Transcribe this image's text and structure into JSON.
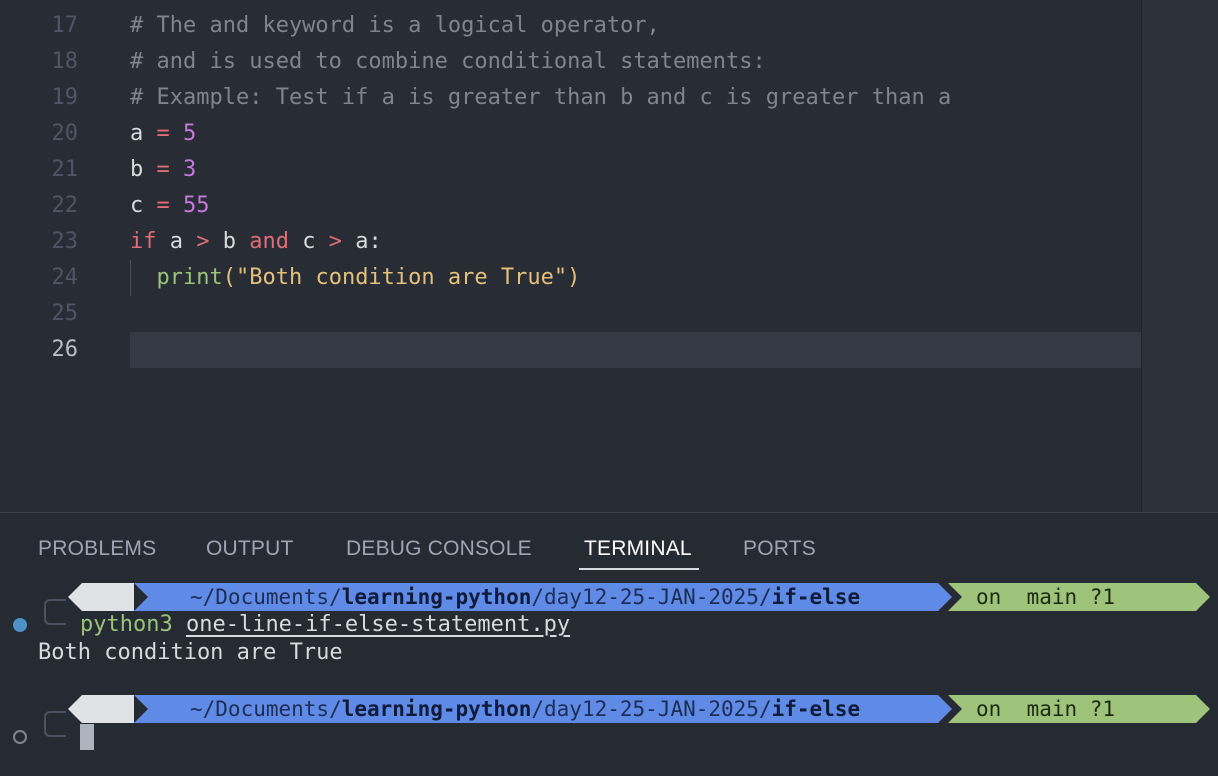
{
  "editor": {
    "lines": [
      {
        "num": "17",
        "tokens": [
          {
            "t": "# The and keyword is a logical operator,",
            "c": "c-comment"
          }
        ]
      },
      {
        "num": "18",
        "tokens": [
          {
            "t": "# and is used to combine conditional statements:",
            "c": "c-comment"
          }
        ]
      },
      {
        "num": "19",
        "tokens": [
          {
            "t": "# Example: Test if a is greater than b and c is greater than a",
            "c": "c-comment"
          }
        ]
      },
      {
        "num": "20",
        "tokens": [
          {
            "t": "a ",
            "c": "c-id"
          },
          {
            "t": "=",
            "c": "c-op"
          },
          {
            "t": " ",
            "c": "c-id"
          },
          {
            "t": "5",
            "c": "c-num"
          }
        ]
      },
      {
        "num": "21",
        "tokens": [
          {
            "t": "b ",
            "c": "c-id"
          },
          {
            "t": "=",
            "c": "c-op"
          },
          {
            "t": " ",
            "c": "c-id"
          },
          {
            "t": "3",
            "c": "c-num"
          }
        ]
      },
      {
        "num": "22",
        "tokens": [
          {
            "t": "c ",
            "c": "c-id"
          },
          {
            "t": "=",
            "c": "c-op"
          },
          {
            "t": " ",
            "c": "c-id"
          },
          {
            "t": "55",
            "c": "c-num"
          }
        ]
      },
      {
        "num": "23",
        "tokens": [
          {
            "t": "if",
            "c": "c-kw"
          },
          {
            "t": " a ",
            "c": "c-id"
          },
          {
            "t": ">",
            "c": "c-op"
          },
          {
            "t": " b ",
            "c": "c-id"
          },
          {
            "t": "and",
            "c": "c-kw"
          },
          {
            "t": " c ",
            "c": "c-id"
          },
          {
            "t": ">",
            "c": "c-op"
          },
          {
            "t": " a:",
            "c": "c-id"
          }
        ]
      },
      {
        "num": "24",
        "indent": true,
        "tokens": [
          {
            "t": "  ",
            "c": "c-id"
          },
          {
            "t": "print",
            "c": "c-fn"
          },
          {
            "t": "(",
            "c": "c-paren"
          },
          {
            "t": "\"Both condition are True\"",
            "c": "c-str"
          },
          {
            "t": ")",
            "c": "c-paren"
          }
        ]
      },
      {
        "num": "25",
        "tokens": []
      },
      {
        "num": "26",
        "current": true,
        "tokens": []
      }
    ]
  },
  "panel": {
    "tabs": [
      "PROBLEMS",
      "OUTPUT",
      "DEBUG CONSOLE",
      "TERMINAL",
      "PORTS"
    ],
    "active_tab": "TERMINAL"
  },
  "terminal": {
    "prompt": {
      "apple_icon": "",
      "folder_icon": "",
      "path_prefix": "~/Documents/",
      "path_repo": "learning-python",
      "path_mid": "/day12-25-JAN-2025/",
      "path_dir": "if-else",
      "git_text": "on  main ?1"
    },
    "command_exe": "python3",
    "command_arg": "one-line-if-else-statement.py",
    "output": "Both condition are True"
  },
  "colors": {
    "editor_bg": "#282c34",
    "panel_bg": "#262a32",
    "path_segment": "#5f8ae6",
    "git_segment": "#9ec47c",
    "status_dot": "#4d93c7"
  },
  "icons": {
    "apple": "apple-icon",
    "folder": "folder-icon",
    "git_branch": "git-branch-icon",
    "github": "github-icon"
  }
}
